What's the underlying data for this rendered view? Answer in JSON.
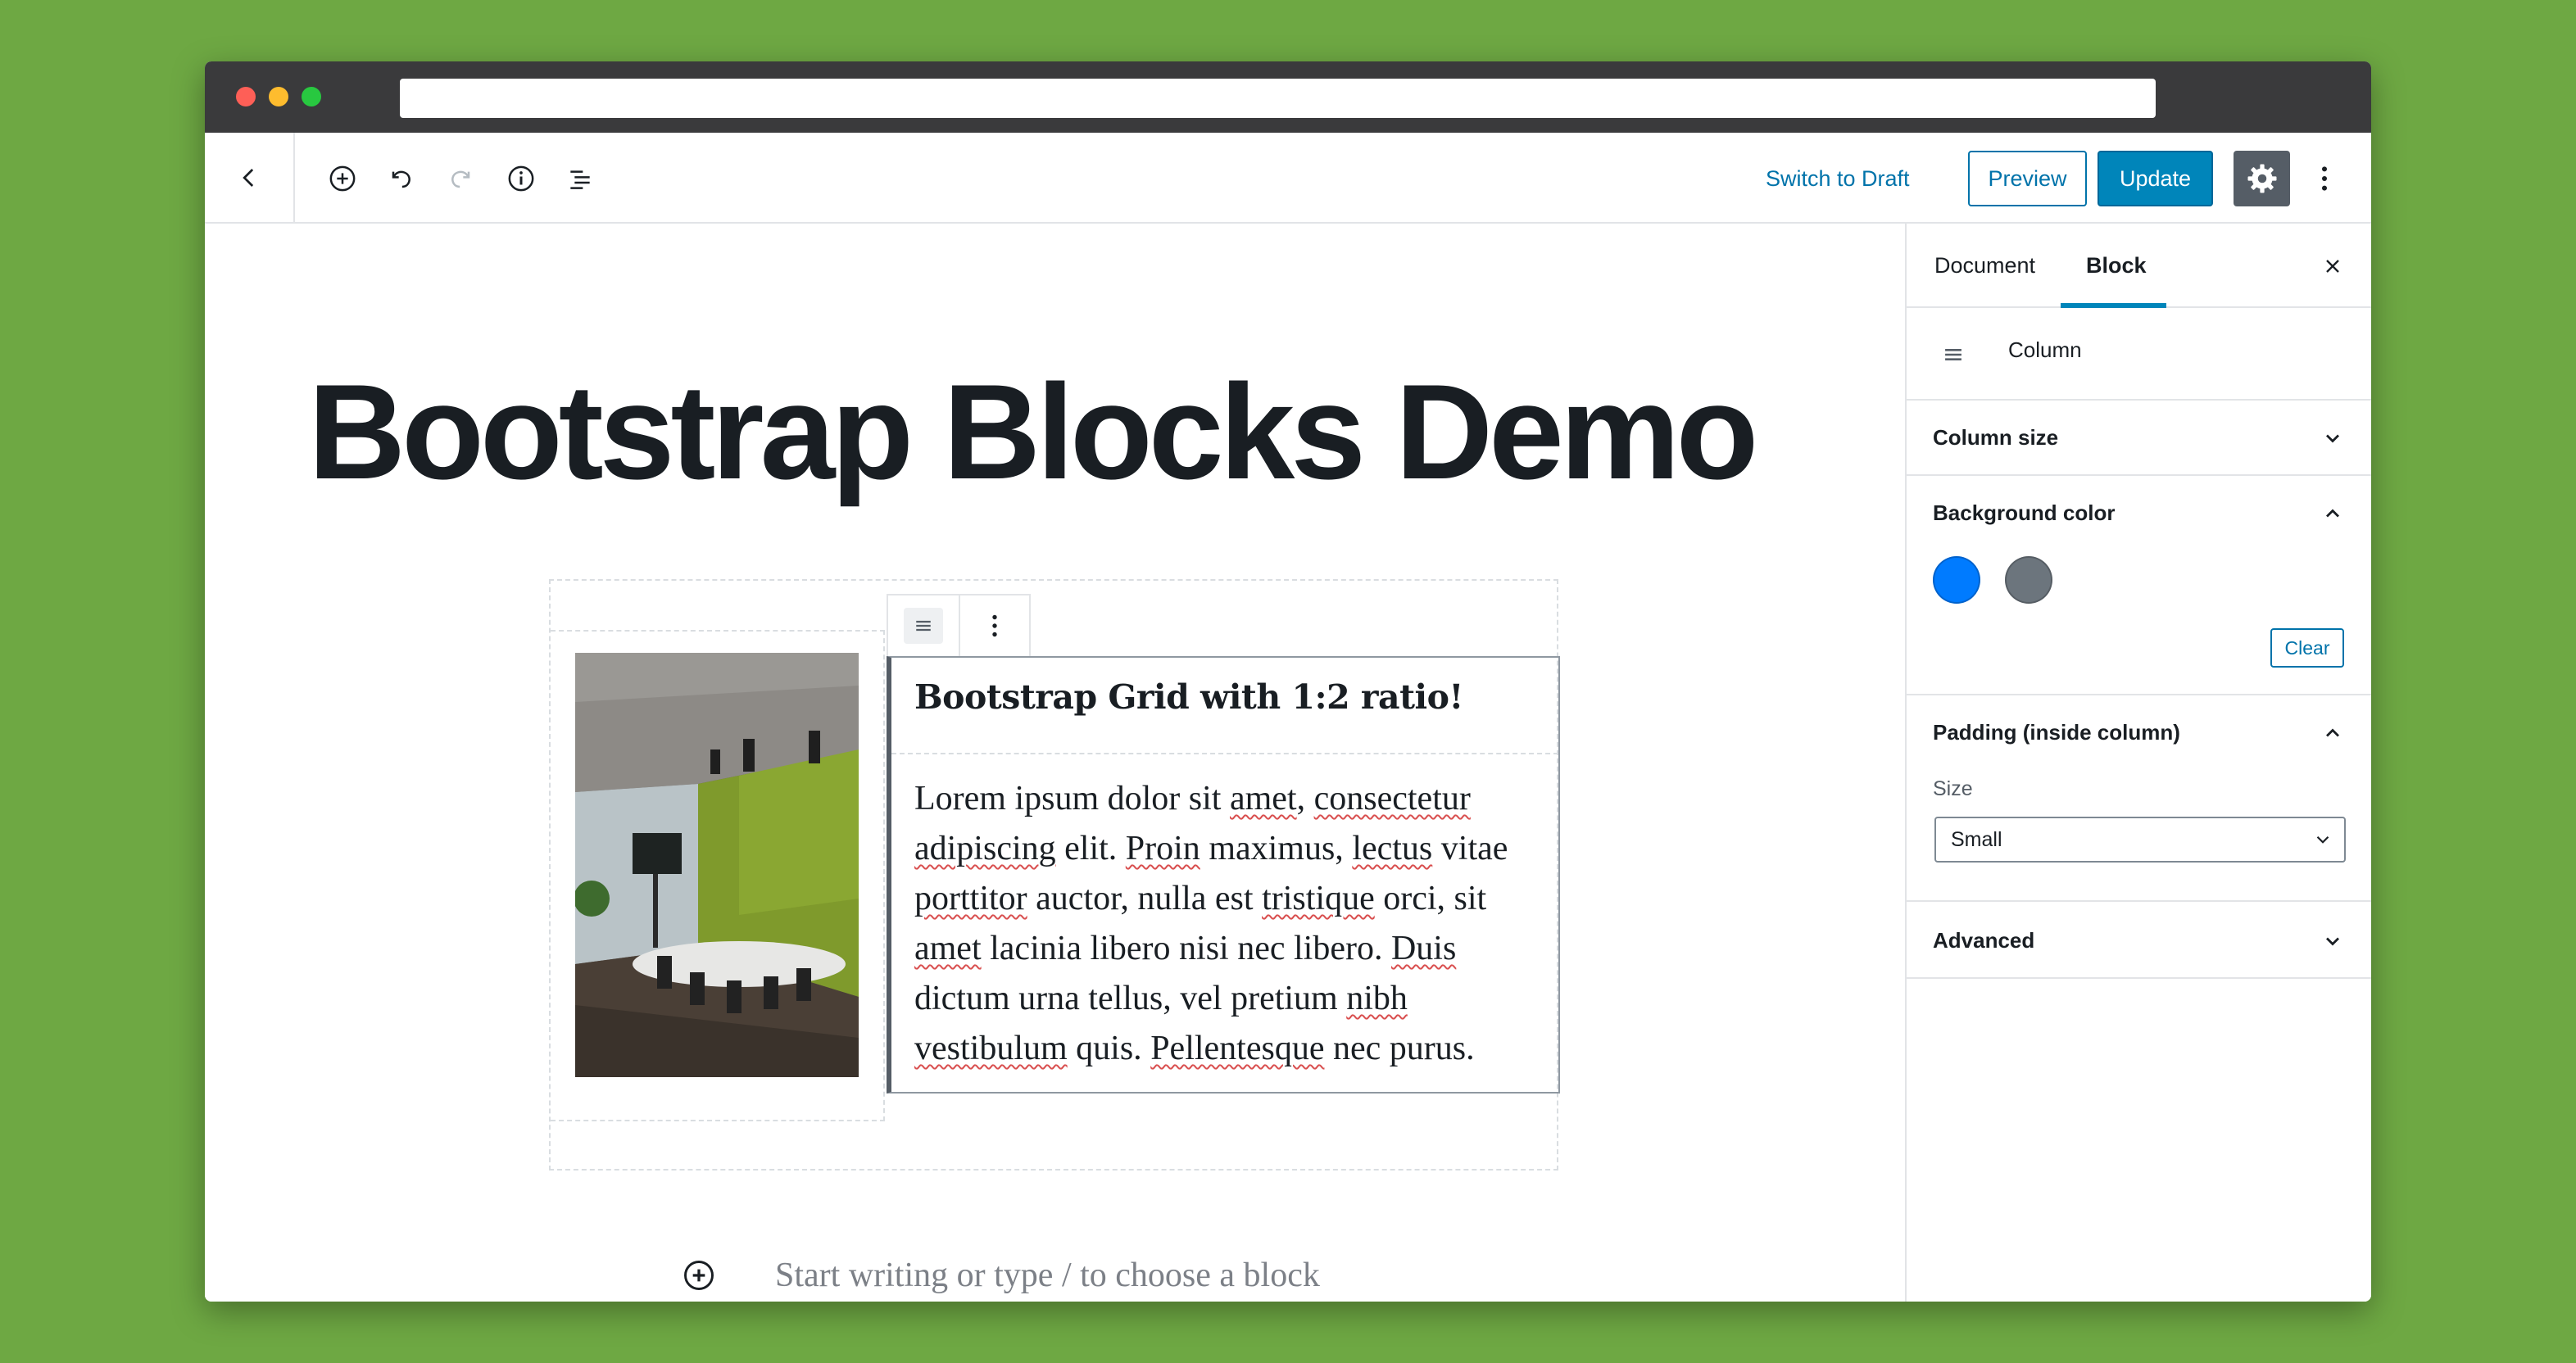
{
  "toolbar": {
    "switch_to_draft": "Switch to Draft",
    "preview": "Preview",
    "update": "Update",
    "icons": [
      "back-chevron",
      "add-block",
      "undo",
      "redo",
      "info",
      "block-navigation",
      "settings-gear",
      "more-vertical"
    ]
  },
  "editor": {
    "post_title": "Bootstrap Blocks Demo",
    "heading": "Bootstrap Grid with 1:2 ratio!",
    "paragraph_segments": [
      {
        "text": "Lorem ipsum dolor sit ",
        "spell": false
      },
      {
        "text": "amet",
        "spell": true
      },
      {
        "text": ", ",
        "spell": false
      },
      {
        "text": "consectetur",
        "spell": true
      },
      {
        "text": " ",
        "spell": false
      },
      {
        "text": "adipiscing",
        "spell": true
      },
      {
        "text": " elit. ",
        "spell": false
      },
      {
        "text": "Proin",
        "spell": true
      },
      {
        "text": " maximus, ",
        "spell": false
      },
      {
        "text": "lectus",
        "spell": true
      },
      {
        "text": " vitae ",
        "spell": false
      },
      {
        "text": "porttitor",
        "spell": true
      },
      {
        "text": " auctor, nulla est ",
        "spell": false
      },
      {
        "text": "tristique",
        "spell": true
      },
      {
        "text": " orci, sit ",
        "spell": false
      },
      {
        "text": "amet",
        "spell": true
      },
      {
        "text": " lacinia libero nisi nec libero. ",
        "spell": false
      },
      {
        "text": "Duis",
        "spell": true
      },
      {
        "text": " dictum urna tellus, vel pretium ",
        "spell": false
      },
      {
        "text": "nibh",
        "spell": true
      },
      {
        "text": " ",
        "spell": false
      },
      {
        "text": "vestibulum",
        "spell": true
      },
      {
        "text": " quis. ",
        "spell": false
      },
      {
        "text": "Pellentesque",
        "spell": true
      },
      {
        "text": " nec purus.",
        "spell": false
      }
    ],
    "placeholder": "Start writing or type / to choose a block"
  },
  "sidebar": {
    "tabs": [
      {
        "label": "Document",
        "active": false
      },
      {
        "label": "Block",
        "active": true
      }
    ],
    "block_name": "Column",
    "panels": {
      "column_size": {
        "title": "Column size",
        "expanded": false
      },
      "background_color": {
        "title": "Background color",
        "expanded": true,
        "swatches": [
          {
            "name": "primary",
            "color": "#007bff"
          },
          {
            "name": "secondary",
            "color": "#6c757d"
          }
        ],
        "clear_label": "Clear"
      },
      "padding": {
        "title": "Padding (inside column)",
        "expanded": true,
        "size_label": "Size",
        "size_value": "Small"
      },
      "advanced": {
        "title": "Advanced",
        "expanded": false
      }
    }
  },
  "colors": {
    "background": "#6ea843",
    "accent": "#0085ba",
    "link": "#0073aa"
  }
}
